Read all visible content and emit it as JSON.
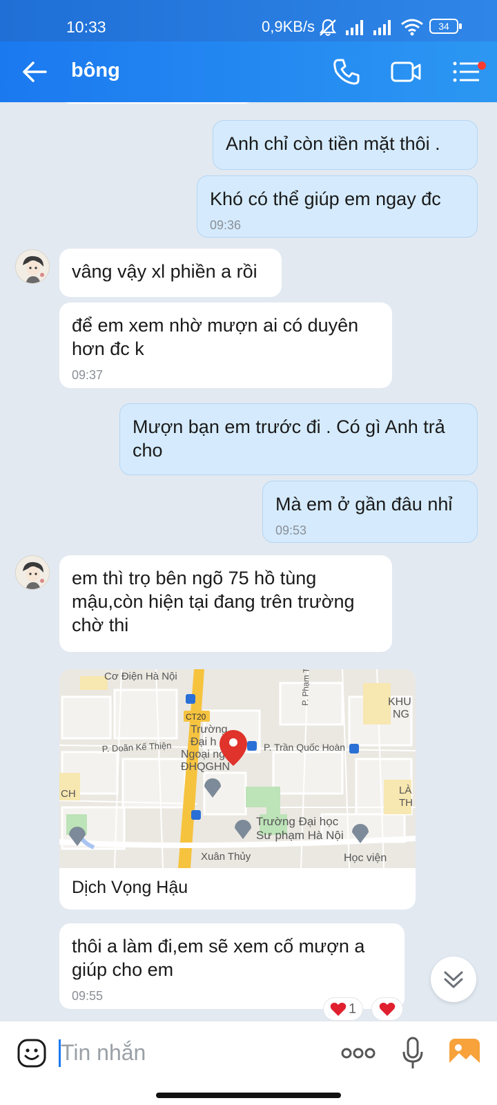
{
  "status_bar": {
    "time": "10:33",
    "network_speed": "0,9KB/s",
    "battery": "34",
    "icons": [
      "mute-bell-icon",
      "signal-icon",
      "signal-icon",
      "wifi-icon",
      "battery-icon"
    ]
  },
  "header": {
    "contact_name": "bông",
    "icons": [
      "back-arrow-icon",
      "phone-icon",
      "video-call-icon",
      "menu-list-icon"
    ],
    "accent": "#1b79f0",
    "notification_dot_color": "#ff3b30"
  },
  "messages": [
    {
      "side": "me",
      "text": "Anh chỉ còn tiền mặt thôi ."
    },
    {
      "side": "me",
      "text": "Khó có thể giúp em ngay đc",
      "time": "09:36"
    },
    {
      "side": "them",
      "text": "vâng vậy xl phiền a rồi"
    },
    {
      "side": "them",
      "text": "để em xem nhờ mượn ai có duyên hơn đc k",
      "time": "09:37"
    },
    {
      "side": "me",
      "text": "Mượn bạn em trước đi . Có gì Anh trả cho"
    },
    {
      "side": "me",
      "text": "Mà em ở gần đâu nhỉ",
      "time": "09:53"
    },
    {
      "side": "them",
      "text": "em thì trọ bên ngõ 75 hồ tùng mậu,còn hiện tại đang trên trường chờ thi"
    },
    {
      "side": "them",
      "text": "thôi a làm đi,em sẽ xem cố mượn a giúp cho em",
      "time": "09:55"
    }
  ],
  "map_card": {
    "location_name": "Dịch Vọng Hậu",
    "labels": [
      "Cơ Điện Hà Nội",
      "CT20",
      "P. Phạm Tuấn",
      "KHU",
      "NG",
      "Trường",
      "Đại h",
      "Ngoại ngữ",
      "ĐHQGHN",
      "P. Trần Quốc Hoàn",
      "P. Doãn Kế Thiện",
      "CH",
      "LÀ",
      "TH",
      "Trường Đại học",
      "Sư phạm Hà Nội",
      "Xuân Thủy",
      "Học viện"
    ]
  },
  "reactions": [
    {
      "icon": "heart-icon",
      "count": "1"
    },
    {
      "icon": "heart-icon",
      "count": ""
    }
  ],
  "composer": {
    "placeholder": "Tin nhắn",
    "icons": [
      "emoji-icon",
      "more-icon",
      "microphone-icon",
      "image-gallery-icon"
    ]
  },
  "colors": {
    "my_bubble": "#d5ebfd",
    "their_bubble": "#ffffff",
    "background": "#e2e9f1",
    "heart": "#e0202f"
  }
}
